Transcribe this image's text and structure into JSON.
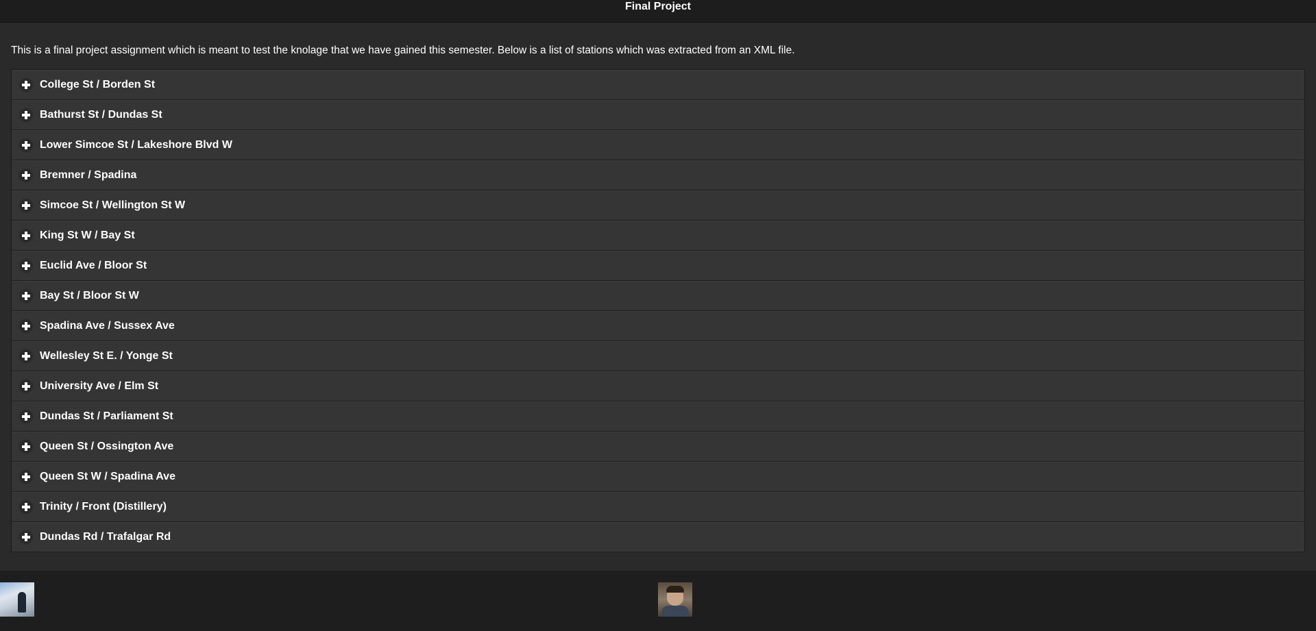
{
  "header": {
    "title": "Final Project"
  },
  "intro": "This is a final project assignment which is meant to test the knolage that we have gained this semester. Below is a list of stations which was extracted from an XML file.",
  "stations": [
    "College St / Borden St",
    "Bathurst St / Dundas St",
    "Lower Simcoe St / Lakeshore Blvd W",
    "Bremner / Spadina",
    "Simcoe St / Wellington St W",
    "King St W / Bay St",
    "Euclid Ave / Bloor St",
    "Bay St / Bloor St W",
    "Spadina Ave / Sussex Ave",
    "Wellesley St E. / Yonge St",
    "University Ave / Elm St",
    "Dundas St / Parliament St",
    "Queen St / Ossington Ave",
    "Queen St W / Spadina Ave",
    "Trinity / Front (Distillery)",
    "Dundas Rd / Trafalgar Rd"
  ],
  "icons": {
    "expand": "plus-icon"
  }
}
